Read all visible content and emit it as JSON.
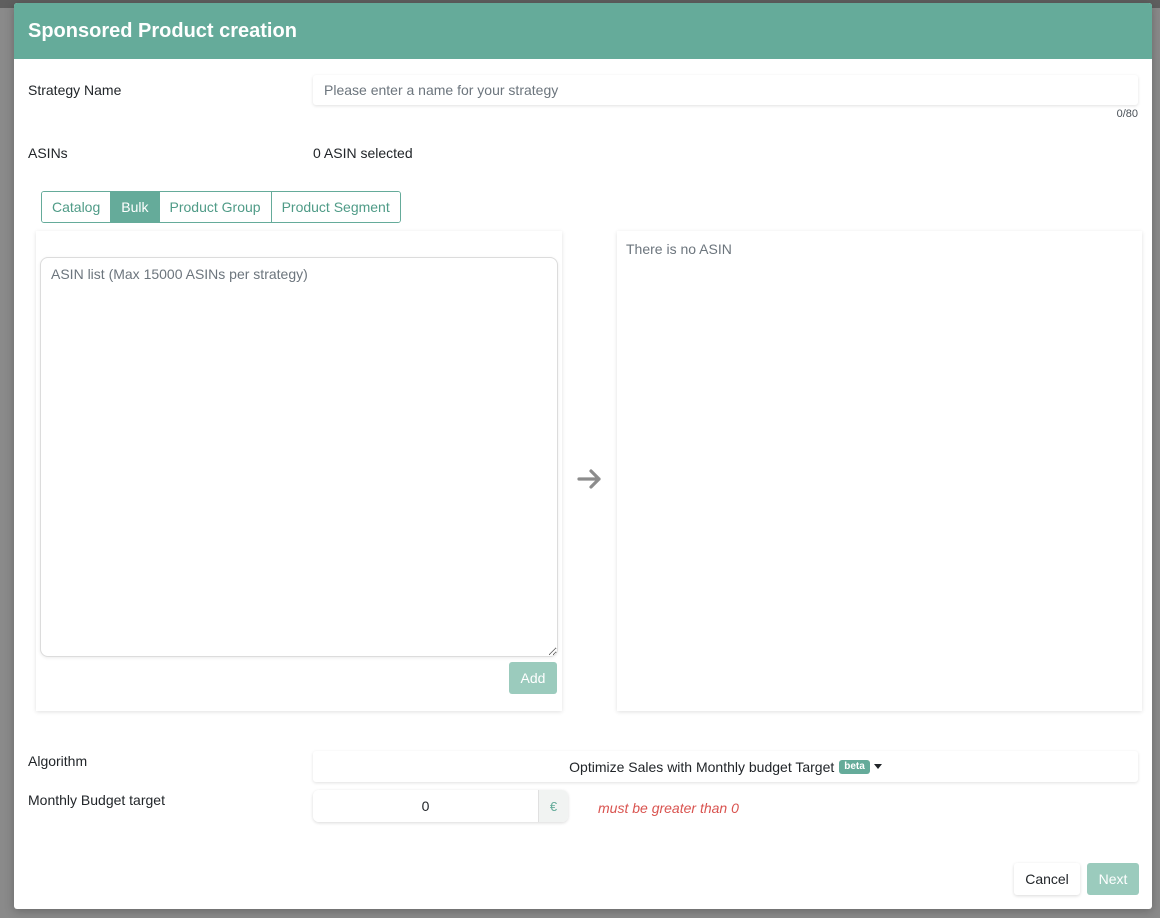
{
  "modal": {
    "title": "Sponsored Product creation"
  },
  "strategy_name": {
    "label": "Strategy Name",
    "placeholder": "Please enter a name for your strategy",
    "value": "",
    "char_count": "0/80"
  },
  "asins": {
    "label": "ASINs",
    "selected_text": "0 ASIN selected",
    "tabs": [
      {
        "label": "Catalog",
        "active": false
      },
      {
        "label": "Bulk",
        "active": true
      },
      {
        "label": "Product Group",
        "active": false
      },
      {
        "label": "Product Segment",
        "active": false
      }
    ],
    "textarea_placeholder": "ASIN list (Max 15000 ASINs per strategy)",
    "add_label": "Add",
    "empty_text": "There is no ASIN"
  },
  "algorithm": {
    "label": "Algorithm",
    "selected": "Optimize Sales with Monthly budget Target",
    "badge": "beta"
  },
  "budget": {
    "label": "Monthly Budget target",
    "value": "0",
    "currency": "€",
    "error": "must be greater than 0"
  },
  "footer": {
    "cancel_label": "Cancel",
    "next_label": "Next"
  },
  "colors": {
    "accent": "#65ab9a",
    "accent_disabled": "#9bcbbd",
    "error": "#d9534f"
  }
}
